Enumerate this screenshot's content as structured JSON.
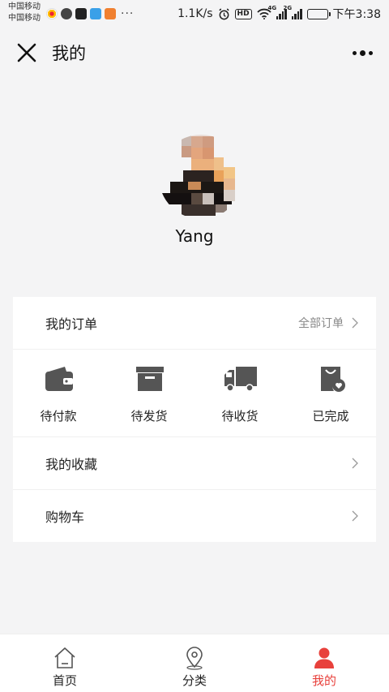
{
  "status_bar": {
    "carrier_1": "中国移动",
    "carrier_2": "中国移动",
    "network_speed": "1.1K/s",
    "hd_badge": "HD",
    "signal_1_tag": "4G",
    "signal_2_tag": "2G",
    "time": "下午3:38",
    "notification_icons": [
      "weibo-icon",
      "chat-icon",
      "tiktok-icon",
      "blue-app-icon",
      "orange-app-icon"
    ],
    "battery_color": "#38c860"
  },
  "header": {
    "title": "我的",
    "close_icon": "close-icon",
    "more_icon": "more-dots-icon"
  },
  "profile": {
    "username": "Yang"
  },
  "orders": {
    "title": "我的订单",
    "all_orders": "全部订单",
    "statuses": [
      {
        "label": "待付款",
        "icon": "wallet-icon"
      },
      {
        "label": "待发货",
        "icon": "box-icon"
      },
      {
        "label": "待收货",
        "icon": "truck-icon"
      },
      {
        "label": "已完成",
        "icon": "bag-heart-icon"
      }
    ]
  },
  "menu": {
    "favorites": "我的收藏",
    "cart": "购物车"
  },
  "tabbar": {
    "accent": "#e8413c",
    "items": [
      {
        "label": "首页",
        "icon": "home-icon"
      },
      {
        "label": "分类",
        "icon": "location-pin-icon"
      },
      {
        "label": "我的",
        "icon": "user-icon",
        "active": true
      }
    ]
  }
}
